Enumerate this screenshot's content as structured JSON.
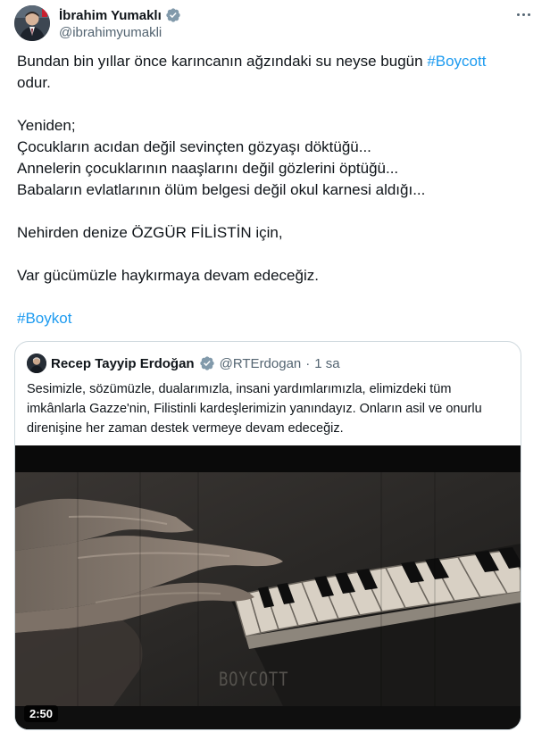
{
  "author": {
    "display_name": "İbrahim Yumaklı",
    "handle": "@ibrahimyumakli",
    "verified": true
  },
  "tweet": {
    "line1_text": "Bundan bin yıllar önce karıncanın ağzındaki su neyse bugün ",
    "line1_hashtag": "#Boycott",
    "line2": "odur.",
    "line3": "Yeniden;",
    "line4": "Çocukların acıdan değil sevinçten gözyaşı döktüğü...",
    "line5": "Annelerin çocuklarının naaşlarını değil gözlerini öptüğü...",
    "line6": "Babaların evlatlarının ölüm belgesi değil okul karnesi aldığı...",
    "line7": "Nehirden denize ÖZGÜR FİLİSTİN için,",
    "line8": "Var gücümüzle haykırmaya devam edeceğiz.",
    "hashtag2": "#Boykot"
  },
  "quote": {
    "display_name": "Recep Tayyip Erdoğan",
    "handle": "@RTErdogan",
    "separator": "·",
    "time": "1 sa",
    "verified": true,
    "text": "Sesimizle, sözümüzle, dualarımızla, insani yardımlarımızla, elimizdeki tüm imkânlarla Gazze'nin, Filistinli kardeşlerimizin yanındayız. Onların asil ve onurlu direnişine her zaman destek vermeye devam edeceğiz.",
    "video": {
      "duration": "2:50",
      "watermark": "BOYCOTT"
    }
  },
  "colors": {
    "link": "#1d9bf0",
    "text": "#0f1419",
    "secondary": "#536471",
    "border": "#cfd9de"
  },
  "icons": {
    "verified": "verified-badge-icon",
    "more": "more-options-icon"
  }
}
